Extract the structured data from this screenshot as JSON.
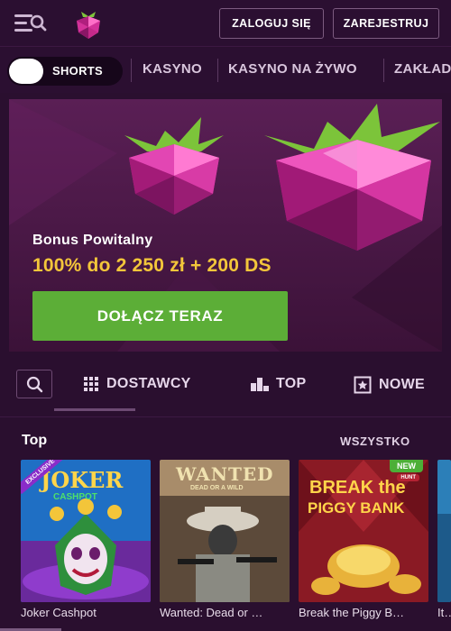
{
  "header": {
    "login_label": "ZALOGUJ SIĘ",
    "register_label": "ZAREJESTRUJ",
    "menu_icon": "menu-search-icon",
    "logo_icon": "raspberry-logo-icon"
  },
  "catnav": {
    "shorts_label": "SHORTS",
    "items": [
      "KASYNO",
      "KASYNO NA ŻYWO",
      "ZAKŁAD"
    ]
  },
  "banner": {
    "subtitle": "Bonus Powitalny",
    "offer": "100% do 2 250 zł + 200 DS",
    "cta": "DOŁĄCZ TERAZ",
    "offer_color": "#f3c63a",
    "cta_color": "#5cae37"
  },
  "filters": {
    "search_icon": "search-icon",
    "tabs": [
      {
        "label": "DOSTAWCY",
        "icon": "grid-icon"
      },
      {
        "label": "TOP",
        "icon": "podium-icon"
      },
      {
        "label": "NOWE",
        "icon": "star-box-icon"
      }
    ]
  },
  "section": {
    "title": "Top",
    "see_all": "WSZYSTKO"
  },
  "games": [
    {
      "title": "Joker Cashpot",
      "art_text": "JOKER",
      "art_sub": "CASHPOT",
      "badge": "EXCLUSIVE"
    },
    {
      "title": "Wanted: Dead or …",
      "art_text": "WANTED",
      "art_sub": "DEAD OR A WILD"
    },
    {
      "title": "Break the Piggy B…",
      "art_text": "BREAK the",
      "art_sub": "PIGGY BANK",
      "badge": "NEW",
      "badge_sub": "HUNT"
    },
    {
      "title": "It…"
    }
  ]
}
